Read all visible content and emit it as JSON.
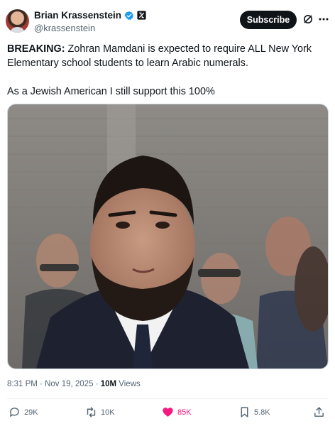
{
  "author": {
    "display_name": "Brian Krassenstein",
    "handle": "@krassenstein",
    "verified_icon": "verified-badge-icon",
    "affiliation_icon": "affiliation-badge-icon"
  },
  "header": {
    "subscribe_label": "Subscribe",
    "grok_icon": "grok-icon",
    "more_icon": "more-options-icon"
  },
  "post": {
    "breaking_label": "BREAKING:",
    "line1_rest": " Zohran Mamdani is expected to require ALL New York Elementary school students to learn Arabic numerals.",
    "line2": "As a Jewish American I still support this 100%"
  },
  "meta": {
    "time": "8:31 PM",
    "separator": " · ",
    "date": "Nov 19, 2025",
    "separator2": " · ",
    "views_count": "10M",
    "views_label": " Views"
  },
  "actions": {
    "replies": "29K",
    "reposts": "10K",
    "likes": "85K",
    "bookmarks": "5.8K"
  },
  "colors": {
    "accent_like": "#f91880",
    "verified": "#1d9bf0",
    "text_secondary": "#536471"
  }
}
